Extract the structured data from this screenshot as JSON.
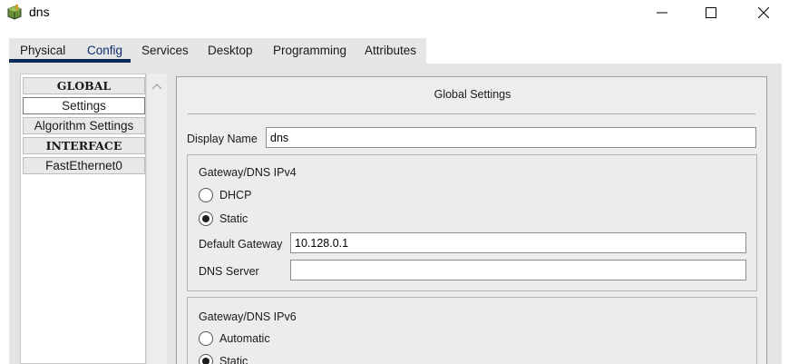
{
  "window": {
    "title": "dns",
    "icon": "router-icon"
  },
  "tabs": [
    {
      "label": "Physical"
    },
    {
      "label": "Config"
    },
    {
      "label": "Services"
    },
    {
      "label": "Desktop"
    },
    {
      "label": "Programming"
    },
    {
      "label": "Attributes"
    }
  ],
  "active_tab": "Config",
  "sidebar": {
    "items": [
      {
        "label": "GLOBAL"
      },
      {
        "label": "Settings"
      },
      {
        "label": "Algorithm Settings"
      },
      {
        "label": "INTERFACE"
      },
      {
        "label": "FastEthernet0"
      }
    ],
    "selected": "Settings"
  },
  "panel": {
    "title": "Global Settings",
    "display_name_label": "Display Name",
    "display_name_value": "dns",
    "ipv4": {
      "title": "Gateway/DNS IPv4",
      "dhcp_label": "DHCP",
      "static_label": "Static",
      "selected": "Static",
      "gateway_label": "Default Gateway",
      "gateway_value": "10.128.0.1",
      "dns_label": "DNS Server",
      "dns_value": ""
    },
    "ipv6": {
      "title": "Gateway/DNS IPv6",
      "automatic_label": "Automatic",
      "static_label": "Static",
      "selected": "Static"
    }
  },
  "colors": {
    "tab_underline": "#0b2a55",
    "active_tab_text": "#0c2f6e",
    "panel_bg": "#ededed",
    "frame_bg": "#e4e4e4"
  }
}
